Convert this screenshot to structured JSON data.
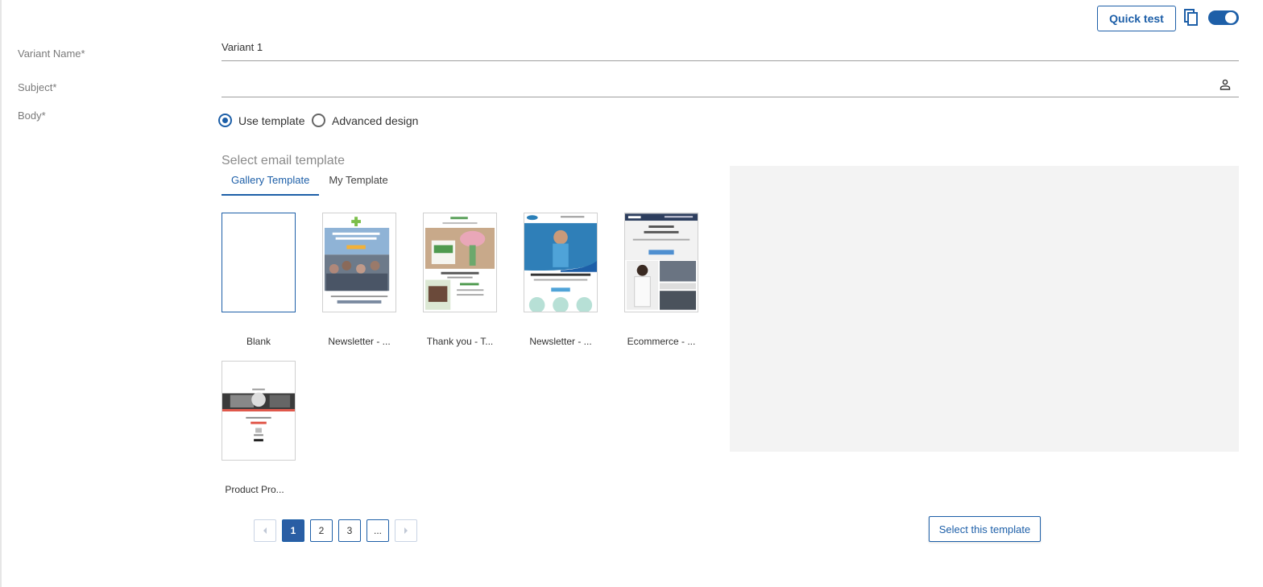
{
  "header": {
    "quick_test_label": "Quick test",
    "copy_icon": "copy-icon",
    "toggle_on": true
  },
  "form": {
    "variant_name_label": "Variant Name*",
    "variant_name_value": "Variant 1",
    "subject_label": "Subject*",
    "subject_value": "",
    "personalize_icon": "person-icon",
    "body_label": "Body*"
  },
  "body_mode": {
    "options": [
      {
        "label": "Use template",
        "checked": true
      },
      {
        "label": "Advanced design",
        "checked": false
      }
    ]
  },
  "templates": {
    "section_title": "Select email template",
    "tabs": [
      {
        "label": "Gallery Template",
        "active": true
      },
      {
        "label": "My Template",
        "active": false
      }
    ],
    "items": [
      {
        "name": "Blank",
        "selected": true
      },
      {
        "name": "Newsletter - ...",
        "selected": false
      },
      {
        "name": "Thank you - T...",
        "selected": false
      },
      {
        "name": "Newsletter - ...",
        "selected": false
      },
      {
        "name": "Ecommerce - ...",
        "selected": false
      },
      {
        "name": "Product Pro...",
        "selected": false
      }
    ]
  },
  "pagination": {
    "prev_icon": "chevron-left-icon",
    "pages": [
      "1",
      "2",
      "3",
      "..."
    ],
    "active_page": "1",
    "next_icon": "chevron-right-icon"
  },
  "actions": {
    "select_template_label": "Select this template"
  },
  "colors": {
    "accent": "#1d5fa8",
    "preview_bg": "#f3f3f3"
  }
}
